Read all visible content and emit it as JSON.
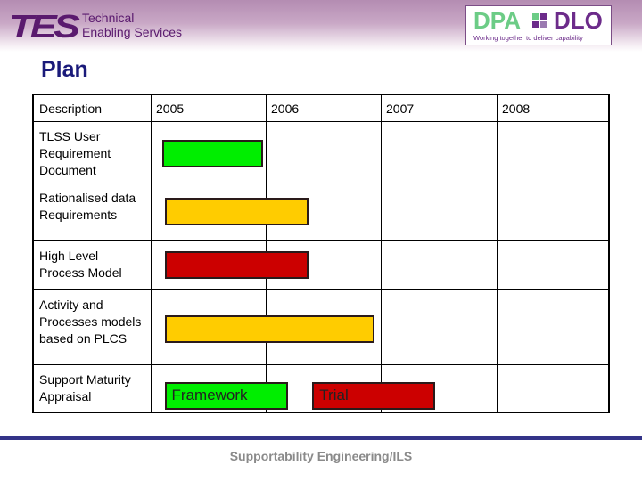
{
  "header": {
    "left_logo": {
      "mark": "TES",
      "line1": "Technical",
      "line2": "Enabling Services"
    },
    "right_logo": {
      "left": "DPA",
      "right": "DLO",
      "tagline": "Working together to deliver capability"
    }
  },
  "title": "Plan",
  "table": {
    "columns": [
      "Description",
      "2005",
      "2006",
      "2007",
      "2008"
    ],
    "rows": [
      {
        "label": "TLSS User Requirement Document"
      },
      {
        "label": "Rationalised data Requirements"
      },
      {
        "label": "High Level Process Model"
      },
      {
        "label": "Activity and Processes models based on PLCS"
      },
      {
        "label": "Support Maturity Appraisal"
      }
    ]
  },
  "bars": [
    {
      "row": 0,
      "start_year": 2005.1,
      "end_year": 2005.97,
      "color": "#00ee00",
      "label": ""
    },
    {
      "row": 1,
      "start_year": 2005.12,
      "end_year": 2006.37,
      "color": "#ffcc00",
      "label": ""
    },
    {
      "row": 2,
      "start_year": 2005.12,
      "end_year": 2006.37,
      "color": "#cc0000",
      "label": ""
    },
    {
      "row": 3,
      "start_year": 2005.12,
      "end_year": 2006.94,
      "color": "#ffcc00",
      "label": ""
    },
    {
      "row": 4,
      "start_year": 2005.12,
      "end_year": 2006.19,
      "color": "#00ee00",
      "label": "Framework"
    },
    {
      "row": 4,
      "start_year": 2006.4,
      "end_year": 2007.46,
      "color": "#cc0000",
      "label": "Trial"
    }
  ],
  "footer": "Supportability Engineering/ILS"
}
